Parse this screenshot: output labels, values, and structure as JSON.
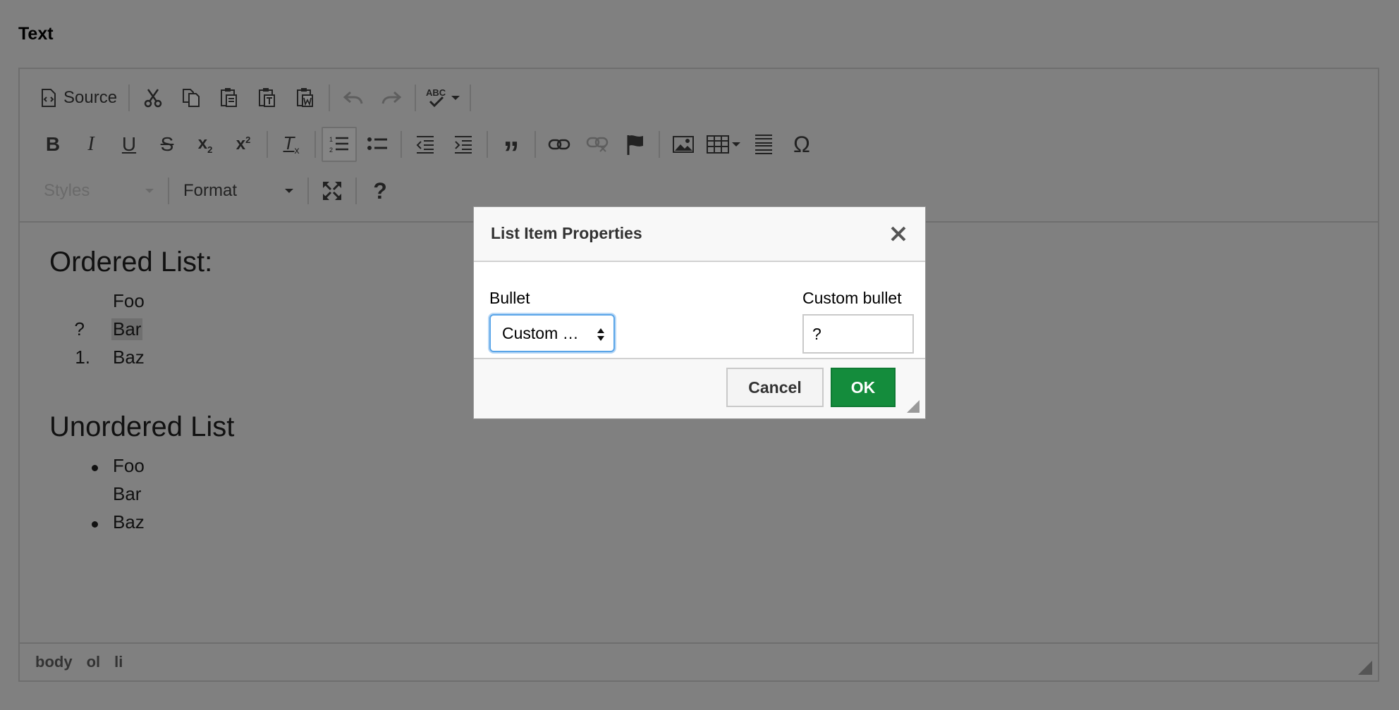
{
  "page": {
    "title": "Text"
  },
  "toolbar": {
    "source_label": "Source",
    "styles_label": "Styles",
    "format_label": "Format",
    "help_label": "?"
  },
  "content": {
    "ordered_heading": "Ordered List:",
    "ordered_items": [
      {
        "marker": "",
        "text": "Foo"
      },
      {
        "marker": "?",
        "text": "Bar"
      },
      {
        "marker": "1.",
        "text": "Baz"
      }
    ],
    "unordered_heading": "Unordered List",
    "unordered_items": [
      {
        "text": "Foo",
        "bullet": true
      },
      {
        "text": "Bar",
        "bullet": false
      },
      {
        "text": "Baz",
        "bullet": true
      }
    ]
  },
  "statusbar": {
    "path": [
      "body",
      "ol",
      "li"
    ]
  },
  "dialog": {
    "title": "List Item Properties",
    "bullet_label": "Bullet",
    "bullet_value": "Custom …",
    "custom_label": "Custom bullet",
    "custom_value": "?",
    "cancel_label": "Cancel",
    "ok_label": "OK"
  },
  "colors": {
    "overlay": "#808080",
    "ok_button": "#148c3c",
    "focus_ring": "#5aa5e8"
  }
}
